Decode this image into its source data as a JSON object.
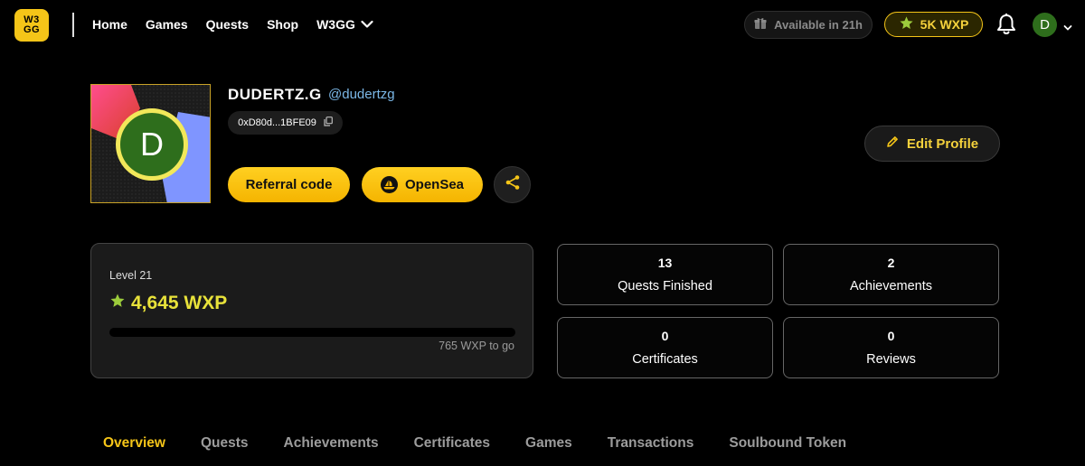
{
  "brand": {
    "logo_line1": "W3",
    "logo_line2": "GG"
  },
  "nav": {
    "items": [
      {
        "label": "Home"
      },
      {
        "label": "Games"
      },
      {
        "label": "Quests"
      },
      {
        "label": "Shop"
      },
      {
        "label": "W3GG"
      }
    ]
  },
  "header": {
    "available_label": "Available in 21h",
    "wxp_balance": "5K WXP",
    "avatar_initial": "D",
    "accent_color": "#f5c518"
  },
  "profile": {
    "display_name": "DUDERTZ.G",
    "handle": "@dudertzg",
    "wallet_address": "0xD80d...1BFE09",
    "avatar_initial": "D",
    "referral_label": "Referral code",
    "opensea_label": "OpenSea",
    "edit_label": "Edit Profile"
  },
  "level": {
    "label": "Level 21",
    "wxp_total": "4,645 WXP",
    "to_go": "765 WXP to go",
    "progress_fraction": 0.0
  },
  "stats": [
    {
      "value": "13",
      "label": "Quests Finished"
    },
    {
      "value": "2",
      "label": "Achievements"
    },
    {
      "value": "0",
      "label": "Certificates"
    },
    {
      "value": "0",
      "label": "Reviews"
    }
  ],
  "tabs": [
    {
      "label": "Overview",
      "active": true
    },
    {
      "label": "Quests"
    },
    {
      "label": "Achievements"
    },
    {
      "label": "Certificates"
    },
    {
      "label": "Games"
    },
    {
      "label": "Transactions"
    },
    {
      "label": "Soulbound Token"
    }
  ]
}
